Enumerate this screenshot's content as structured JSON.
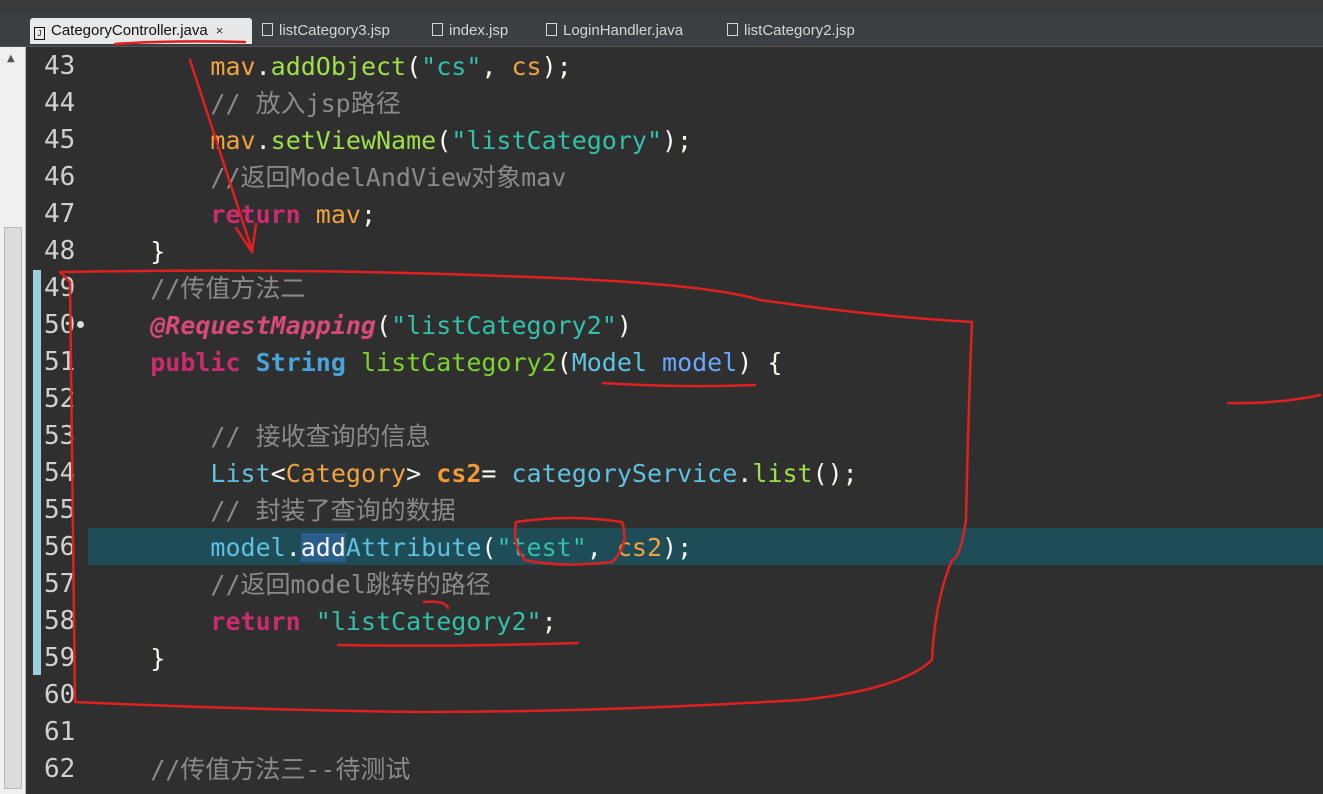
{
  "tabs": [
    {
      "label": "CategoryController.java",
      "close": "×"
    },
    {
      "label": "listCategory3.jsp"
    },
    {
      "label": "index.jsp"
    },
    {
      "label": "LoginHandler.java"
    },
    {
      "label": "listCategory2.jsp"
    }
  ],
  "lines": [
    {
      "num": "43",
      "tokens": [
        [
          "        ",
          ""
        ],
        [
          "mav",
          "var"
        ],
        [
          ".",
          ""
        ],
        [
          "addObject",
          "call"
        ],
        [
          "(",
          ""
        ],
        [
          "\"cs\"",
          "str"
        ],
        [
          ", ",
          ""
        ],
        [
          "cs",
          "var"
        ],
        [
          ");",
          ""
        ]
      ]
    },
    {
      "num": "44",
      "tokens": [
        [
          "        ",
          ""
        ],
        [
          "// 放入jsp路径",
          "cmt"
        ]
      ]
    },
    {
      "num": "45",
      "tokens": [
        [
          "        ",
          ""
        ],
        [
          "mav",
          "var"
        ],
        [
          ".",
          ""
        ],
        [
          "setViewName",
          "call"
        ],
        [
          "(",
          ""
        ],
        [
          "\"listCategory\"",
          "str"
        ],
        [
          ");",
          ""
        ]
      ]
    },
    {
      "num": "46",
      "tokens": [
        [
          "        ",
          ""
        ],
        [
          "//返回ModelAndView对象mav",
          "cmt"
        ]
      ]
    },
    {
      "num": "47",
      "tokens": [
        [
          "        ",
          ""
        ],
        [
          "return",
          "kw"
        ],
        [
          " ",
          ""
        ],
        [
          "mav",
          "var"
        ],
        [
          ";",
          ""
        ]
      ]
    },
    {
      "num": "48",
      "tokens": [
        [
          "    ",
          ""
        ],
        [
          "}",
          ""
        ]
      ]
    },
    {
      "num": "49",
      "tokens": [
        [
          "    ",
          ""
        ],
        [
          "//传值方法二",
          "cmt"
        ]
      ]
    },
    {
      "num": "50",
      "tokens": [
        [
          "    ",
          ""
        ],
        [
          "@RequestMapping",
          "ann"
        ],
        [
          "(",
          ""
        ],
        [
          "\"listCategory2\"",
          "str"
        ],
        [
          ")",
          ""
        ]
      ]
    },
    {
      "num": "51",
      "tokens": [
        [
          "    ",
          ""
        ],
        [
          "public",
          "kw"
        ],
        [
          " ",
          ""
        ],
        [
          "String",
          "typeb"
        ],
        [
          " ",
          ""
        ],
        [
          "listCategory2",
          "meth"
        ],
        [
          "(",
          ""
        ],
        [
          "Model",
          "type"
        ],
        [
          " ",
          ""
        ],
        [
          "model",
          "param"
        ],
        [
          ") {",
          ""
        ]
      ]
    },
    {
      "num": "52",
      "tokens": []
    },
    {
      "num": "53",
      "tokens": [
        [
          "        ",
          ""
        ],
        [
          "// 接收查询的信息",
          "cmt"
        ]
      ]
    },
    {
      "num": "54",
      "tokens": [
        [
          "        ",
          ""
        ],
        [
          "List",
          "type"
        ],
        [
          "<",
          ""
        ],
        [
          "Category",
          "var"
        ],
        [
          "> ",
          ""
        ],
        [
          "cs2",
          "vbold"
        ],
        [
          "= ",
          ""
        ],
        [
          "categoryService",
          "type"
        ],
        [
          ".",
          ""
        ],
        [
          "list",
          "call"
        ],
        [
          "();",
          ""
        ]
      ]
    },
    {
      "num": "55",
      "tokens": [
        [
          "        ",
          ""
        ],
        [
          "// 封装了查询的数据",
          "cmt"
        ]
      ]
    },
    {
      "num": "56",
      "tokens": [
        [
          "        ",
          ""
        ],
        [
          "model",
          "type"
        ],
        [
          ".",
          ""
        ],
        [
          "add",
          "sel"
        ],
        [
          "Attribute",
          "type"
        ],
        [
          "(",
          ""
        ],
        [
          "\"test\"",
          "str"
        ],
        [
          ", ",
          ""
        ],
        [
          "cs2",
          "var"
        ],
        [
          ");",
          ""
        ]
      ]
    },
    {
      "num": "57",
      "tokens": [
        [
          "        ",
          ""
        ],
        [
          "//返回model跳转的路径",
          "cmt"
        ]
      ]
    },
    {
      "num": "58",
      "tokens": [
        [
          "        ",
          ""
        ],
        [
          "return",
          "kw"
        ],
        [
          " ",
          ""
        ],
        [
          "\"listCategory2\"",
          "str"
        ],
        [
          ";",
          ""
        ]
      ]
    },
    {
      "num": "59",
      "tokens": [
        [
          "    ",
          ""
        ],
        [
          "}",
          ""
        ]
      ]
    },
    {
      "num": "60",
      "tokens": []
    },
    {
      "num": "61",
      "tokens": []
    },
    {
      "num": "62",
      "tokens": [
        [
          "    ",
          ""
        ],
        [
          "//传值方法三--待测试",
          "cmt"
        ]
      ]
    }
  ],
  "highlighted_line": "56",
  "colors": {
    "background": "#2f2f2f",
    "current_line": "#1e4d58",
    "annotation_marks": "#e02020"
  }
}
